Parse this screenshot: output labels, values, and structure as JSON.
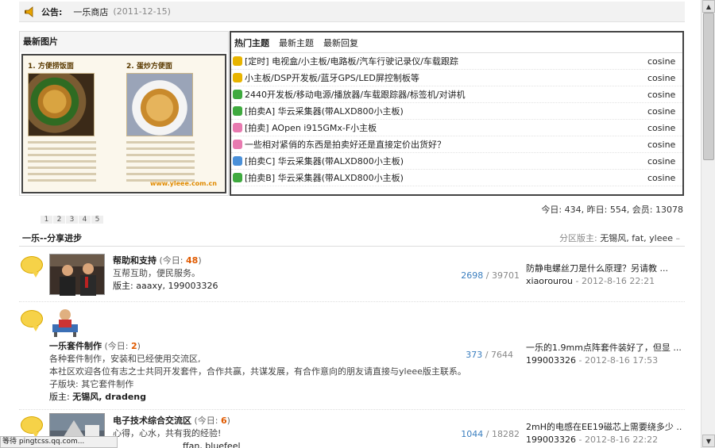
{
  "notice": {
    "label": "公告:",
    "shop": "一乐商店",
    "date": "(2011-12-15)"
  },
  "images": {
    "title": "最新图片",
    "caption_1": "1. 方便捞饭面",
    "caption_2": "2. 蛋炒方便面",
    "watermark": "www.yleee.com.cn",
    "pages": [
      "1",
      "2",
      "3",
      "4",
      "5"
    ]
  },
  "topics": {
    "tabs": [
      "热门主题",
      "最新主题",
      "最新回复"
    ],
    "items": [
      {
        "title": "[定时] 电视盒/小主板/电路板/汽车行驶记录仪/车载跟踪",
        "author": "cosine",
        "color": "#e8b400"
      },
      {
        "title": "小主板/DSP开发板/蓝牙GPS/LED屏控制板等",
        "author": "cosine",
        "color": "#e8b400"
      },
      {
        "title": "2440开发板/移动电源/播放器/车载跟踪器/标签机/对讲机",
        "author": "cosine",
        "color": "#3faa3f"
      },
      {
        "title": "[拍卖A] 华云采集器(带ALXD800小主板)",
        "author": "cosine",
        "color": "#3faa3f"
      },
      {
        "title": "[拍卖] AOpen i915GMx-F小主板",
        "author": "cosine",
        "color": "#e87ab0"
      },
      {
        "title": "一些相对紧俏的东西是拍卖好还是直接定价出货好？",
        "author": "cosine",
        "color": "#e87ab0"
      },
      {
        "title": "[拍卖C] 华云采集器(带ALXD800小主板)",
        "author": "cosine",
        "color": "#4a90d9"
      },
      {
        "title": "[拍卖B] 华云采集器(带ALXD800小主板)",
        "author": "cosine",
        "color": "#3faa3f"
      }
    ]
  },
  "stats": "今日: 434, 昨日: 554, 会员: 13078",
  "category": {
    "title": "一乐--分享进步",
    "mod_label": "分区版主:",
    "mods": "无锡风, fat, yleee",
    "mods_tail": "–"
  },
  "forums": [
    {
      "name": "帮助和支持",
      "today_prefix": "(今日: ",
      "today": "48",
      "today_suffix": ")",
      "desc1": "互帮互助，便民服务。",
      "desc2": "",
      "sub": "",
      "mods_label": "版主:",
      "mods": "aaaxy, 199003326",
      "threads": "2698",
      "posts": "/ 39701",
      "last_title": "防静电螺丝刀是什么原理？另请教 ...",
      "last_user": "xiaorourou",
      "last_time": "- 2012-8-16 22:21"
    },
    {
      "name": "一乐套件制作",
      "today_prefix": "(今日: ",
      "today": "2",
      "today_suffix": ")",
      "desc1": "各种套件制作，安装和已经使用交流区,",
      "desc2": "本社区欢迎各位有志之士共同开发套件，合作共赢，共谋发展，有合作意向的朋友请直接与yleee版主联系。",
      "sub": "子版块: 其它套件制作",
      "mods_label": "版主:",
      "mods": "无锡风, dradeng",
      "threads": "373",
      "posts": "/ 7644",
      "last_title": "一乐的1.9mm点阵套件装好了，但显 ...",
      "last_user": "199003326",
      "last_time": "- 2012-8-16 17:53"
    },
    {
      "name": "电子技术综合交流区",
      "today_prefix": "(今日: ",
      "today": "6",
      "today_suffix": ")",
      "desc1": "心得，心水，共有我的经验!",
      "desc2": "",
      "sub": "",
      "mods_label": "",
      "mods": "ffan, bluefeel",
      "threads": "1044",
      "posts": "/ 18282",
      "last_title": "2mH的电感在EE19磁芯上需要绕多少 ...",
      "last_user": "199003326",
      "last_time": "- 2012-8-16 22:22"
    }
  ],
  "statusbar": "等待 pingtcss.qq.com...",
  "scroll": {
    "up": "▲",
    "down": "▼"
  }
}
